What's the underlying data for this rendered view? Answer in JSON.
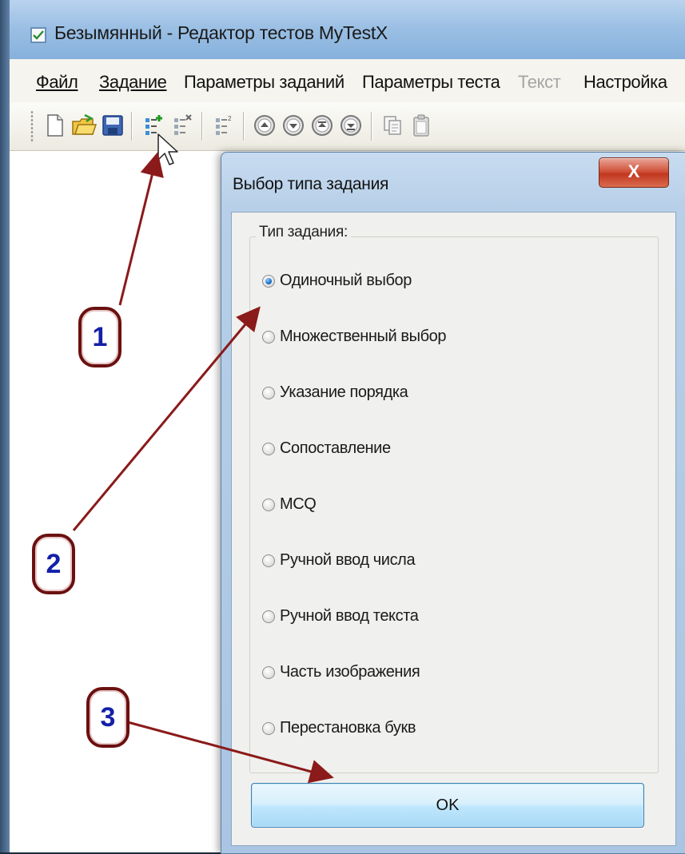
{
  "window": {
    "title": "Безымянный - Редактор тестов MyTestX"
  },
  "menu": {
    "file": "Файл",
    "task": "Задание",
    "task_params": "Параметры заданий",
    "test_params": "Параметры теста",
    "text": "Текст",
    "settings": "Настройка"
  },
  "toolbar": {
    "icons": [
      "new-file-icon",
      "open-folder-icon",
      "save-icon",
      "add-task-icon",
      "delete-task-icon",
      "task-list-icon",
      "move-up-icon",
      "move-down-icon",
      "move-first-icon",
      "move-last-icon",
      "copy-icon",
      "paste-icon"
    ]
  },
  "dialog": {
    "title": "Выбор типа задания",
    "close_label": "X",
    "group_label": "Тип задания:",
    "options": [
      {
        "label": "Одиночный выбор",
        "checked": true
      },
      {
        "label": "Множественный выбор",
        "checked": false
      },
      {
        "label": "Указание порядка",
        "checked": false
      },
      {
        "label": "Сопоставление",
        "checked": false
      },
      {
        "label": "MCQ",
        "checked": false
      },
      {
        "label": "Ручной ввод числа",
        "checked": false
      },
      {
        "label": "Ручной ввод текста",
        "checked": false
      },
      {
        "label": "Часть изображения",
        "checked": false
      },
      {
        "label": "Перестановка букв",
        "checked": false
      }
    ],
    "ok_label": "OK"
  },
  "annotations": {
    "callout_1": "1",
    "callout_2": "2",
    "callout_3": "3",
    "arrow_color": "#8b1a1a",
    "number_color": "#1420a8"
  }
}
